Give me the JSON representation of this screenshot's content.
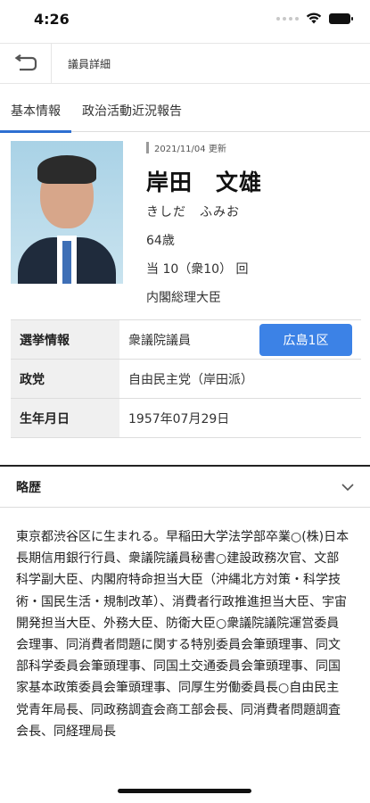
{
  "status": {
    "time": "4:26"
  },
  "nav": {
    "title": "議員詳細"
  },
  "tabs": [
    {
      "label": "基本情報",
      "active": true
    },
    {
      "label": "政治活動近況報告",
      "active": false
    }
  ],
  "profile": {
    "updated": "2021/11/04 更新",
    "name": "岸田　文雄",
    "kana": "きしだ　ふみお",
    "age": "64歳",
    "terms": "当 10（衆10） 回",
    "position": "内閣総理大臣"
  },
  "table": {
    "election_label": "選挙情報",
    "election_value": "衆議院議員",
    "district": "広島1区",
    "party_label": "政党",
    "party_value": "自由民主党（岸田派）",
    "birth_label": "生年月日",
    "birth_value": "1957年07月29日"
  },
  "bio": {
    "title": "略歴",
    "text": "東京都渋谷区に生まれる。早稲田大学法学部卒業○(株)日本長期信用銀行行員、衆議院議員秘書○建設政務次官、文部科学副大臣、内閣府特命担当大臣（沖縄北方対策・科学技術・国民生活・規制改革）、消費者行政推進担当大臣、宇宙開発担当大臣、外務大臣、防衛大臣○衆議院議院運営委員会理事、同消費者問題に関する特別委員会筆頭理事、同文部科学委員会筆頭理事、同国土交通委員会筆頭理事、同国家基本政策委員会筆頭理事、同厚生労働委員長○自由民主党青年局長、同政務調査会商工部会長、同消費者問題調査会長、同経理局長"
  },
  "colors": {
    "accent": "#3c82e6",
    "tab_underline": "#2e6fd2"
  }
}
